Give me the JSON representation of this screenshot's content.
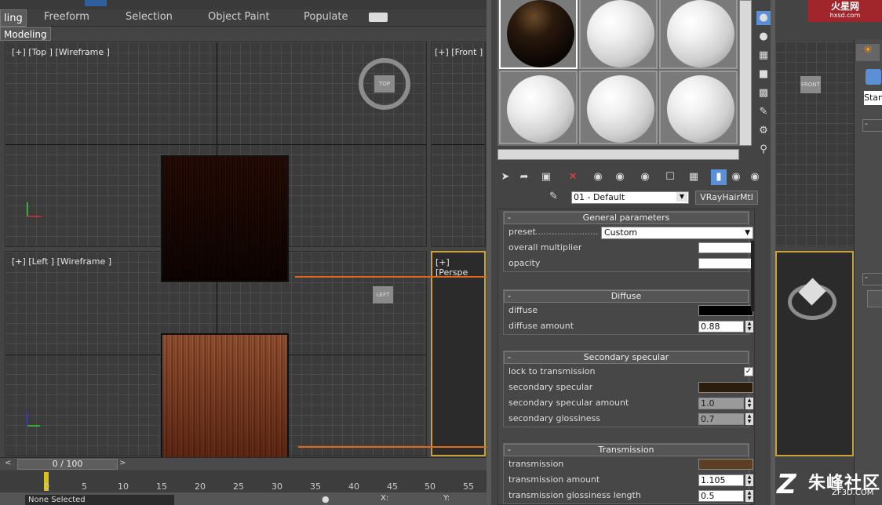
{
  "ribbon": {
    "tabs": [
      "ling",
      "Freeform",
      "Selection",
      "Object Paint",
      "Populate"
    ],
    "sub_tab": "Modeling"
  },
  "viewports": {
    "top_label": "[+] [Top ] [Wireframe ]",
    "front_label": "[+] [Front ]",
    "left_label": "[+] [Left ] [Wireframe ]",
    "persp_label": "[+] [Perspe",
    "top_cube": "TOP",
    "left_cube": "LEFT",
    "front_cube": "FRONT"
  },
  "timeline": {
    "frame": "0 / 100",
    "ticks": [
      "0",
      "5",
      "10",
      "15",
      "20",
      "25",
      "30",
      "35",
      "40",
      "45",
      "50",
      "55"
    ],
    "status": "None Selected",
    "x_label": "X:",
    "y_label": "Y:"
  },
  "material_editor": {
    "name": "01 - Default",
    "type": "VRayHairMtl",
    "general": {
      "title": "General parameters",
      "preset_label": "preset",
      "preset_value": "Custom",
      "overall_multiplier_label": "overall multiplier",
      "opacity_label": "opacity"
    },
    "diffuse": {
      "title": "Diffuse",
      "diffuse_label": "diffuse",
      "amount_label": "diffuse amount",
      "amount_value": "0.88",
      "color": "#000000"
    },
    "secondary": {
      "title": "Secondary specular",
      "lock_label": "lock to transmission",
      "spec_label": "secondary specular",
      "spec_color": "#2a1d0b",
      "amount_label": "secondary specular amount",
      "amount_value": "1.0",
      "gloss_label": "secondary glossiness",
      "gloss_value": "0.7"
    },
    "transmission": {
      "title": "Transmission",
      "trans_label": "transmission",
      "trans_color": "#5a3f22",
      "amount_label": "transmission amount",
      "amount_value": "1.105",
      "gloss_label": "transmission glossiness length",
      "gloss_value": "0.5"
    }
  },
  "right_panel": {
    "dropdown": "Stan"
  },
  "branding": {
    "logo_text": "火星网",
    "logo_sub": "hxsd.com",
    "watermark_big": "朱峰社区",
    "watermark_small": "ZF3D.COM"
  },
  "colors": {
    "accent": "#e0681a",
    "active_tool": "#5b8fd6",
    "persp_border": "#c8a23a"
  }
}
